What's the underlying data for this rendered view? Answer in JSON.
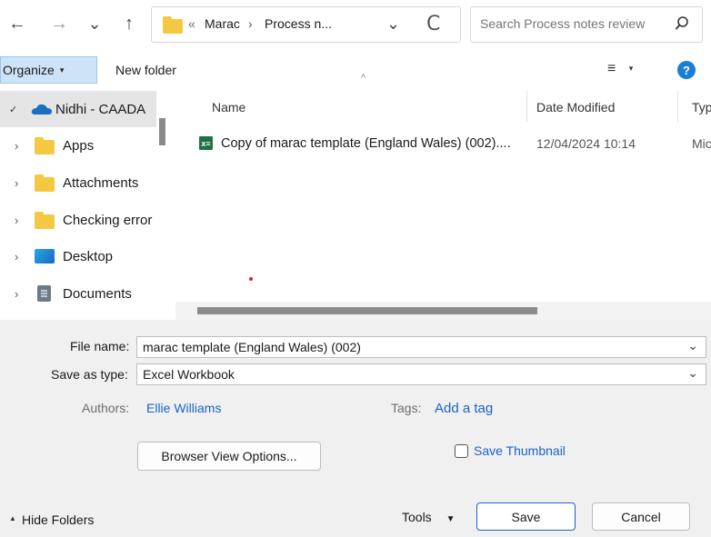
{
  "nav": {
    "back_icon": "←",
    "forward_icon": "→",
    "recent_icon": "⌄",
    "up_icon": "↑"
  },
  "address": {
    "overflow": "«",
    "crumb1": "Marac",
    "sep": "›",
    "crumb2": "Process n...",
    "dropdown_icon": "⌄",
    "refresh_icon": "C"
  },
  "search": {
    "placeholder": "Search Process notes review"
  },
  "toolbar": {
    "organize_label": "Organize",
    "new_folder_label": "New folder"
  },
  "tree": {
    "root_label": "Nidhi - CAADA",
    "items": [
      {
        "label": "Apps",
        "icon": "folder-icon"
      },
      {
        "label": "Attachments",
        "icon": "folder-icon"
      },
      {
        "label": "Checking error",
        "icon": "folder-icon"
      },
      {
        "label": "Desktop",
        "icon": "desktop-icon"
      },
      {
        "label": "Documents",
        "icon": "documents-icon"
      }
    ]
  },
  "columns": {
    "name": "Name",
    "date_modified": "Date Modified",
    "type": "Typ"
  },
  "files": [
    {
      "name": "Copy of marac template (England  Wales) (002)....",
      "date": "12/04/2024 10:14",
      "type": "Mic"
    }
  ],
  "form": {
    "file_name_label": "File name:",
    "file_name_value": "marac template (England  Wales) (002)",
    "save_type_label": "Save as type:",
    "save_type_value": "Excel Workbook",
    "authors_label": "Authors:",
    "authors_value": "Ellie Williams",
    "tags_label": "Tags:",
    "tags_value": "Add a tag",
    "browser_view_label": "Browser View Options...",
    "save_thumbnail_label": "Save Thumbnail"
  },
  "footer": {
    "hide_folders_label": "Hide Folders",
    "tools_label": "Tools",
    "save_label": "Save",
    "cancel_label": "Cancel"
  },
  "colors": {
    "accent": "#1a64c8",
    "selected_bg": "#cde3f7",
    "excel_green": "#1e7145",
    "folder_yellow": "#f5c842"
  }
}
